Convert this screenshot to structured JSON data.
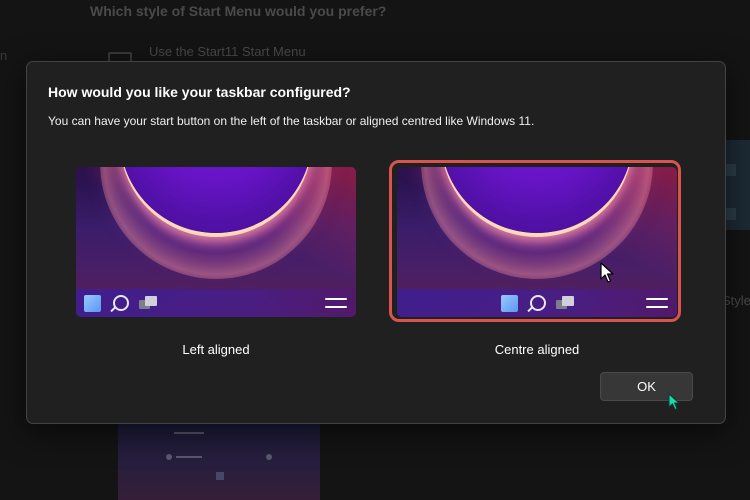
{
  "background": {
    "title": "Which style of Start Menu would you prefer?",
    "option_label": "Use the Start11 Start Menu",
    "partial_left_text": "n",
    "partial_right_text": "Style"
  },
  "dialog": {
    "title": "How would you like your taskbar configured?",
    "subtitle": "You can have your start button on the left of the taskbar or aligned centred like Windows 11.",
    "options": [
      {
        "label": "Left aligned",
        "selected": false
      },
      {
        "label": "Centre aligned",
        "selected": true
      }
    ],
    "ok_label": "OK"
  },
  "colors": {
    "dialog_bg": "#202020",
    "selection_ring": "#d9534f",
    "start_icon": "#7ab0ff",
    "cursor_accent": "#1fd8a8"
  },
  "icons": {
    "start": "windows-start-icon",
    "search": "search-icon",
    "task_view": "task-view-icon",
    "menu": "hamburger-menu-icon"
  }
}
